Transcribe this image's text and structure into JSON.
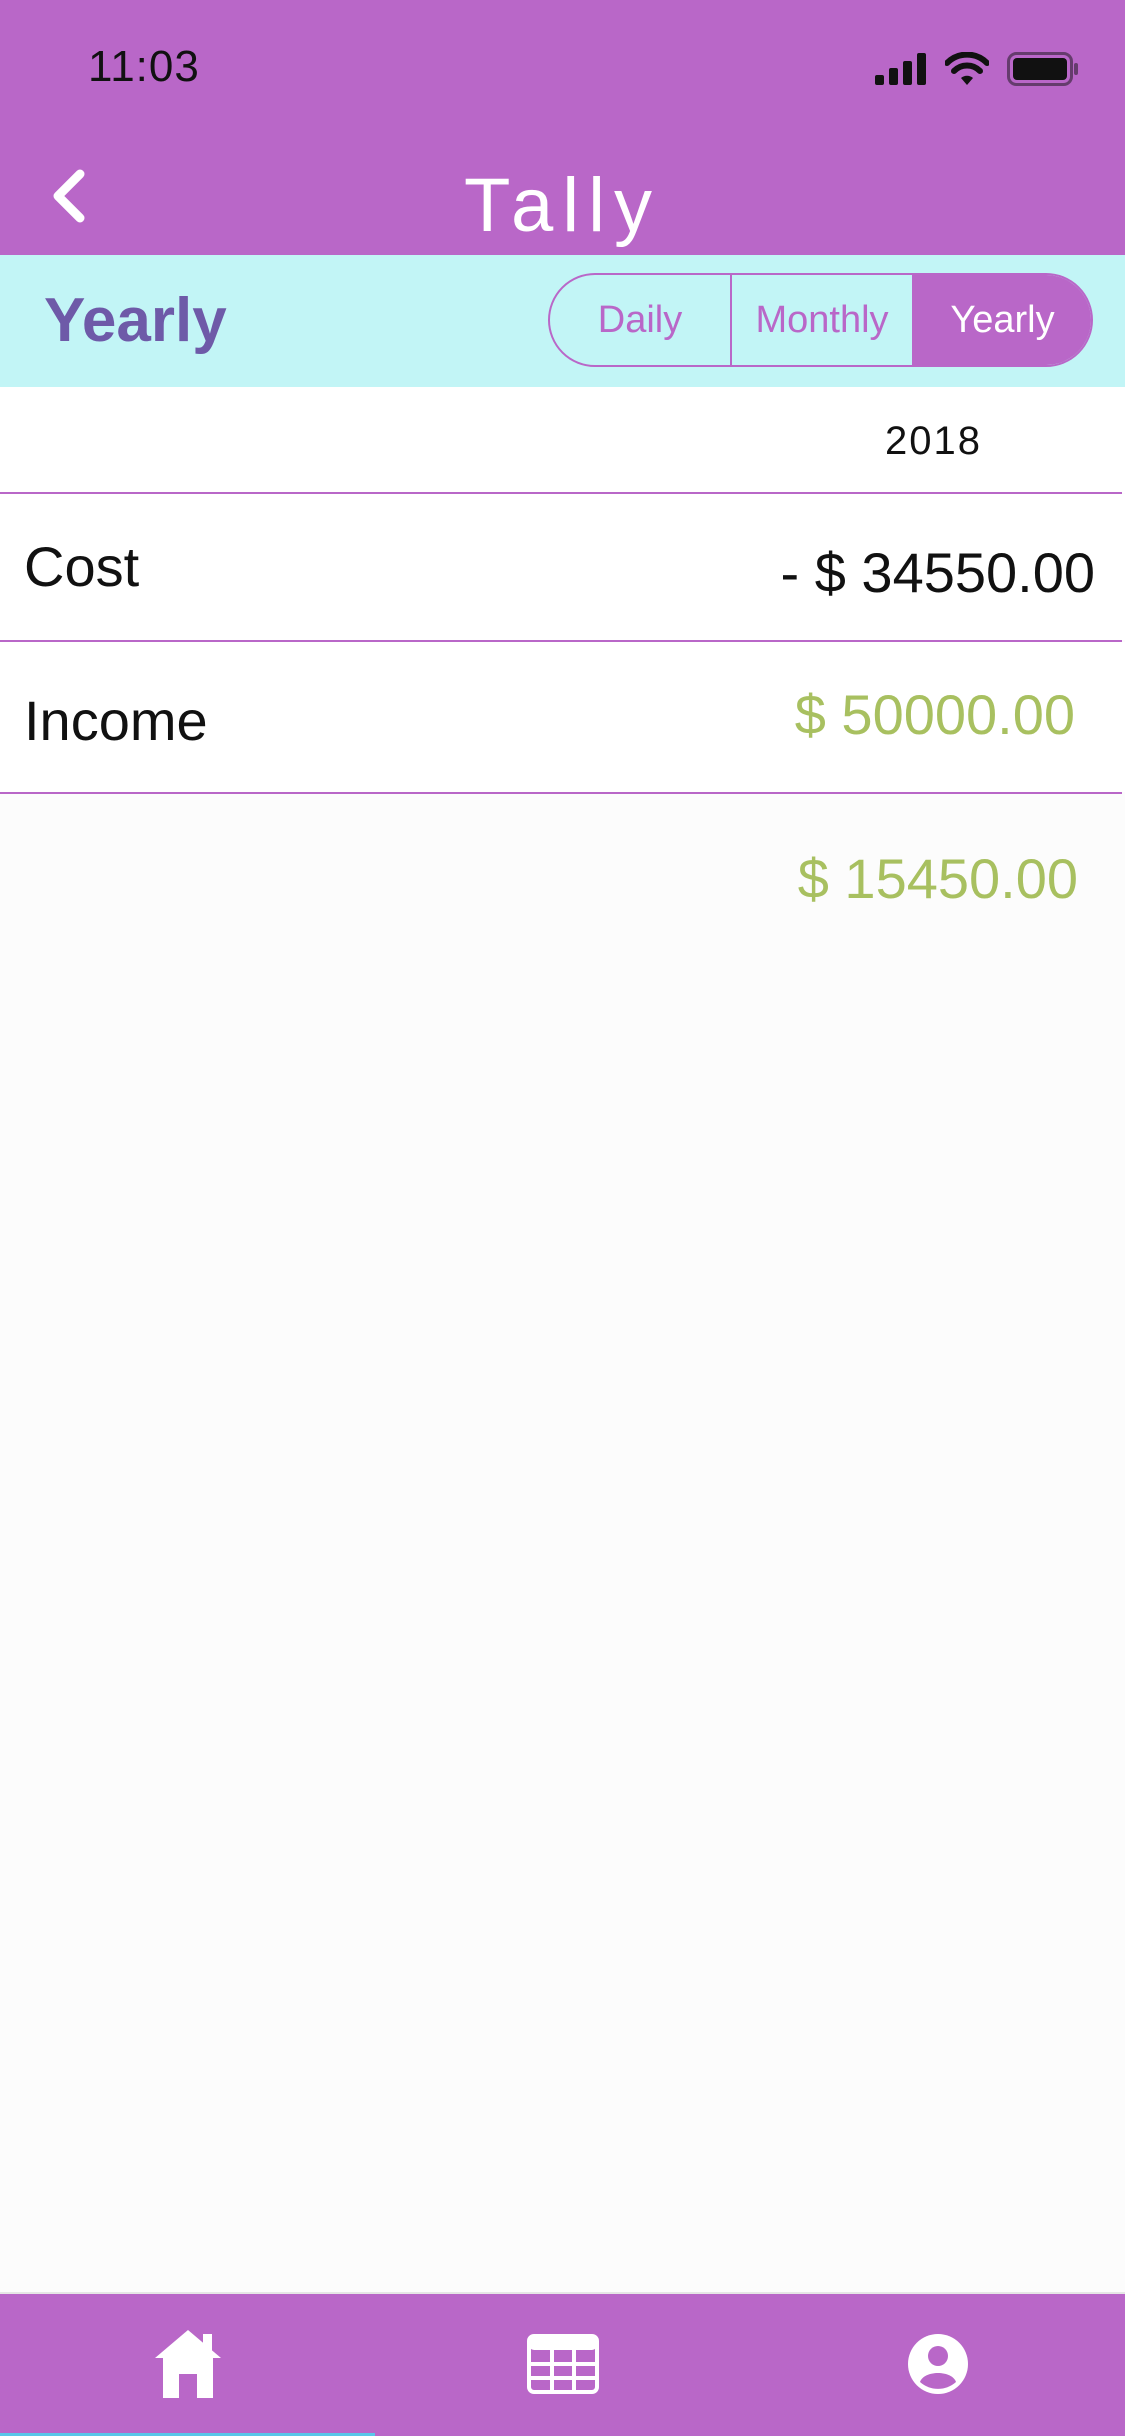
{
  "status_bar": {
    "time": "11:03"
  },
  "header": {
    "title": "Tally",
    "back_icon": "chevron-left-icon"
  },
  "period_bar": {
    "title": "Yearly",
    "options": [
      {
        "label": "Daily",
        "selected": false
      },
      {
        "label": "Monthly",
        "selected": false
      },
      {
        "label": "Yearly",
        "selected": true
      }
    ]
  },
  "summary": {
    "year": "2018",
    "cost": {
      "label": "Cost",
      "value": "- $ 34550.00"
    },
    "income": {
      "label": "Income",
      "value": "$ 50000.00"
    },
    "total": "$ 15450.00"
  },
  "tab_bar": {
    "tabs": [
      {
        "icon": "home-icon",
        "active": true
      },
      {
        "icon": "calendar-grid-icon",
        "active": false
      },
      {
        "icon": "user-profile-icon",
        "active": false
      }
    ]
  },
  "colors": {
    "primary": "#b967c8",
    "segment_background": "#c2f5f6",
    "period_title": "#6e5aa8",
    "positive_value": "#a8c060",
    "text": "#111111",
    "tab_indicator": "#59c6e8"
  }
}
